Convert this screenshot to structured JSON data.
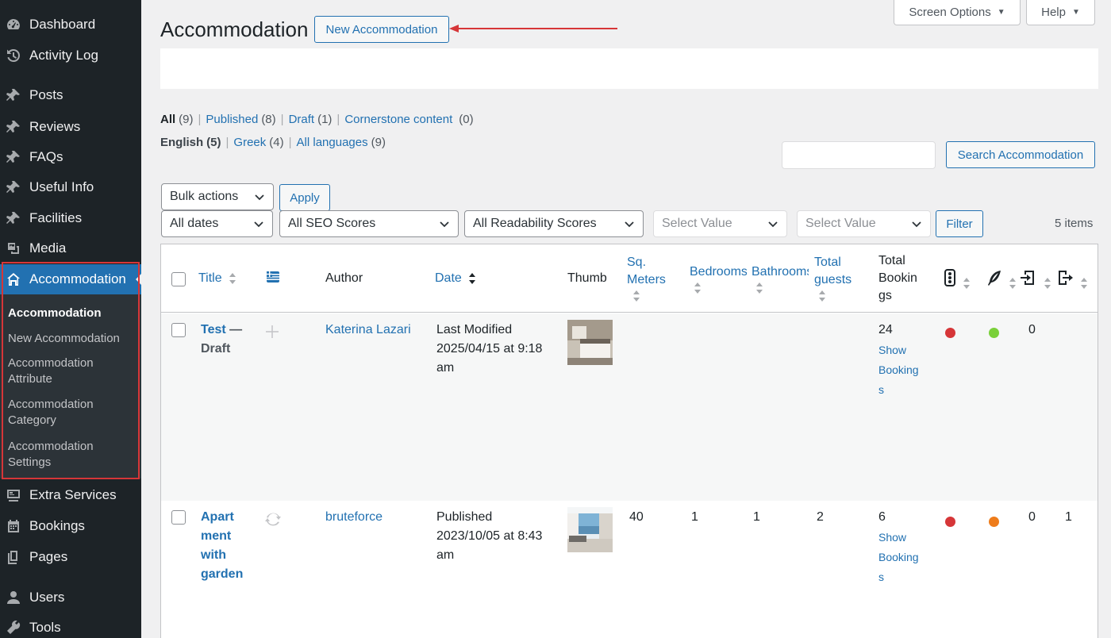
{
  "sidebar": {
    "items": [
      {
        "label": "Dashboard",
        "icon": "dashboard-icon"
      },
      {
        "label": "Activity Log",
        "icon": "history-icon"
      },
      {
        "label": "Posts",
        "icon": "pin-icon"
      },
      {
        "label": "Reviews",
        "icon": "pin-icon"
      },
      {
        "label": "FAQs",
        "icon": "pin-icon"
      },
      {
        "label": "Useful Info",
        "icon": "pin-icon"
      },
      {
        "label": "Facilities",
        "icon": "pin-icon"
      },
      {
        "label": "Media",
        "icon": "media-icon"
      },
      {
        "label": "Accommodation",
        "icon": "home-icon"
      },
      {
        "label": "Extra Services",
        "icon": "services-icon"
      },
      {
        "label": "Bookings",
        "icon": "calendar-icon"
      },
      {
        "label": "Pages",
        "icon": "pages-icon"
      },
      {
        "label": "Users",
        "icon": "users-icon"
      },
      {
        "label": "Tools",
        "icon": "wrench-icon"
      }
    ],
    "submenu": [
      "Accommodation",
      "New Accommodation",
      "Accommodation Attribute",
      "Accommodation Category",
      "Accommodation Settings"
    ]
  },
  "header": {
    "title": "Accommodation",
    "new_button": "New Accommodation",
    "screen_options": "Screen Options",
    "help": "Help"
  },
  "views": {
    "all": "All",
    "all_count": "(9)",
    "published": "Published",
    "published_count": "(8)",
    "draft": "Draft",
    "draft_count": "(1)",
    "cornerstone": "Cornerstone content",
    "cornerstone_count": "(0)",
    "english": "English",
    "english_count": "(5)",
    "greek": "Greek",
    "greek_count": "(4)",
    "all_languages": "All languages",
    "all_languages_count": "(9)"
  },
  "search": {
    "button": "Search Accommodation",
    "value": ""
  },
  "filters": {
    "bulk_actions": "Bulk actions",
    "apply": "Apply",
    "all_dates": "All dates",
    "seo_scores": "All SEO Scores",
    "readability_scores": "All Readability Scores",
    "select_value_1": "Select Value",
    "select_value_2": "Select Value",
    "filter": "Filter",
    "items_count": "5 items"
  },
  "table": {
    "columns": {
      "title": "Title",
      "author": "Author",
      "date": "Date",
      "thumb": "Thumb",
      "sq_meters_1": "Sq.",
      "sq_meters_2": "Meters",
      "bedrooms": "Bedrooms",
      "bathrooms": "Bathrooms",
      "total_guests_1": "Total",
      "total_guests_2": "guests",
      "total_bookings_1": "Total",
      "total_bookings_2": "Bookin",
      "total_bookings_3": "gs"
    },
    "rows": [
      {
        "title_1": "Test",
        "title_sep": " —",
        "state": "Draft",
        "author": "Katerina Lazari",
        "date_1": "Last Modified",
        "date_2": "2025/04/15 at 9:18",
        "date_3": "am",
        "sq_meters": "",
        "bedrooms": "",
        "bathrooms": "",
        "total_guests": "",
        "bookings": "24",
        "show_1": "Show",
        "show_2": "Booking",
        "show_3": "s",
        "seo_color": "#d63638",
        "readability_color": "#7ad03a",
        "links_in": "0",
        "links_out": ""
      },
      {
        "title_1": "Apart",
        "title_2": "ment",
        "title_3": "with",
        "title_4": "garden",
        "author": "bruteforce",
        "date_1": "Published",
        "date_2": "2023/10/05 at 8:43",
        "date_3": "am",
        "sq_meters": "40",
        "bedrooms": "1",
        "bathrooms": "1",
        "total_guests": "2",
        "bookings": "6",
        "show_1": "Show",
        "show_2": "Booking",
        "show_3": "s",
        "seo_color": "#d63638",
        "readability_color": "#ee7c1b",
        "links_in": "0",
        "links_out": "1"
      }
    ]
  },
  "colors": {
    "accent": "#2271b1",
    "sidebar": "#1d2327",
    "highlight": "#d63638"
  }
}
